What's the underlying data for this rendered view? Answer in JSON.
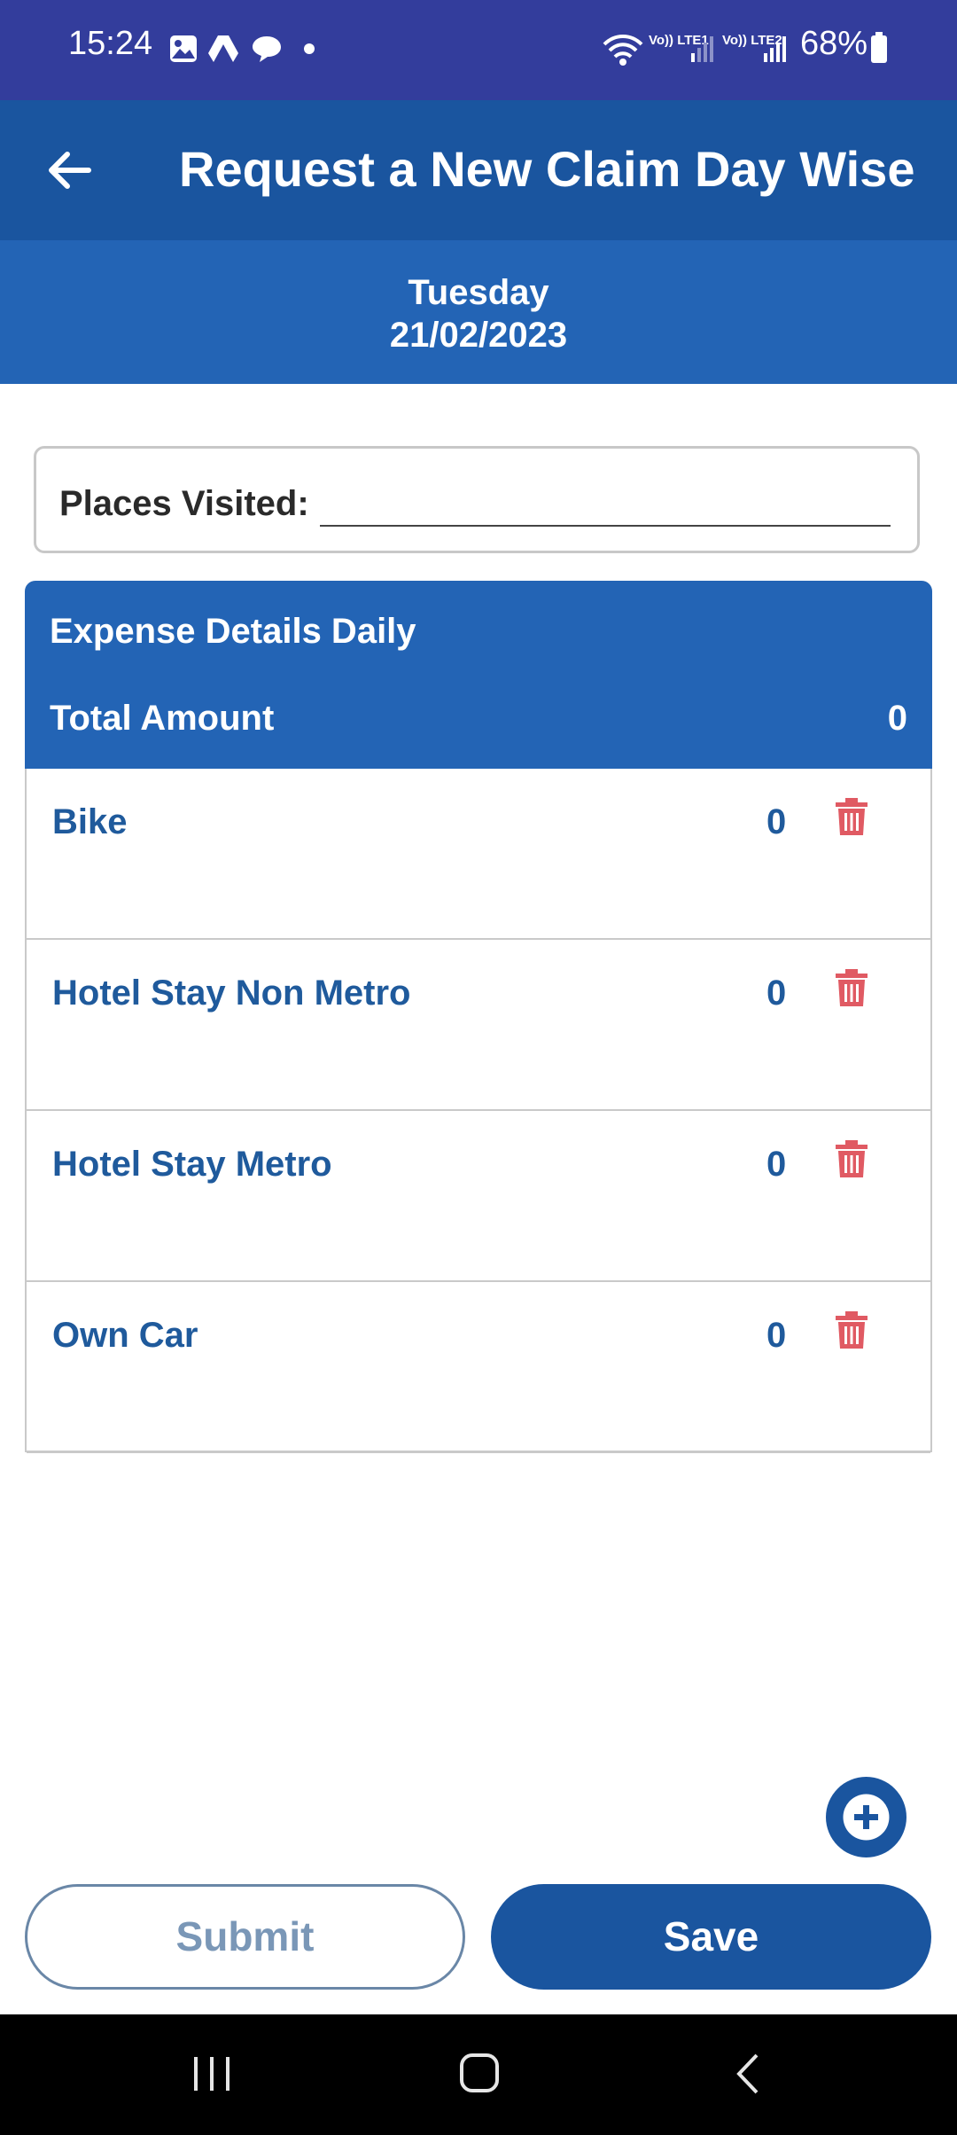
{
  "status_bar": {
    "time": "15:24",
    "battery": "68%",
    "notification_icons": [
      "image-icon",
      "drive-icon",
      "chat-icon",
      "dot-icon"
    ],
    "system_icons": [
      "wifi-icon",
      "lte1-signal-icon",
      "lte2-signal-icon",
      "battery-icon"
    ],
    "lte1": "Vo)) LTE1",
    "lte2": "Vo)) LTE2"
  },
  "header": {
    "title": "Request a New Claim Day Wise",
    "back_icon": "back-arrow-icon"
  },
  "date_band": {
    "day": "Tuesday",
    "date": "21/02/2023"
  },
  "places": {
    "label": "Places Visited:",
    "value": ""
  },
  "expense_panel": {
    "heading": "Expense Details Daily",
    "total_label": "Total Amount",
    "total_value": "0",
    "items": [
      {
        "name": "Bike",
        "amount": "0"
      },
      {
        "name": "Hotel Stay Non Metro",
        "amount": "0"
      },
      {
        "name": "Hotel Stay Metro",
        "amount": "0"
      },
      {
        "name": "Own Car",
        "amount": "0"
      }
    ]
  },
  "actions": {
    "submit": "Submit",
    "save": "Save",
    "add_icon": "plus-icon"
  },
  "colors": {
    "status_bar": "#333d9c",
    "app_bar": "#1a559f",
    "date_band": "#2364b5",
    "item_text": "#1f5a9c",
    "delete": "#e05a63"
  },
  "nav_bar": {
    "icons": [
      "recents-icon",
      "home-icon",
      "back-icon"
    ]
  }
}
